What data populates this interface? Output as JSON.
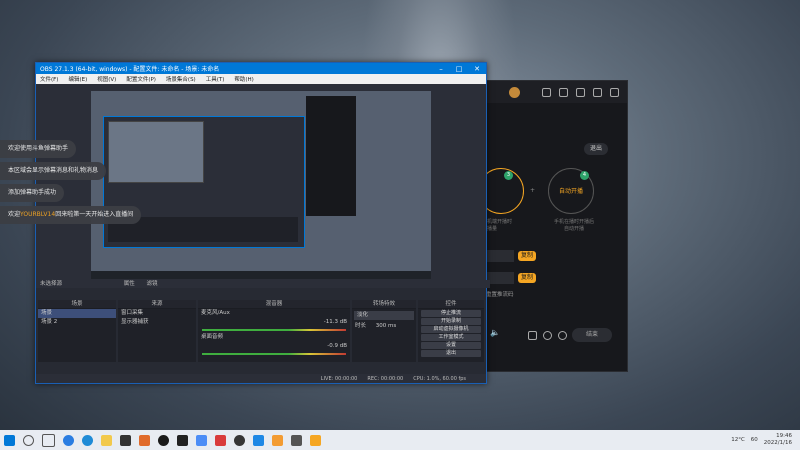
{
  "obs": {
    "title": "OBS 27.1.3 (64-bit, windows) - 配置文件: 未命名 - 场景: 未命名",
    "menu": [
      "文件(F)",
      "编辑(E)",
      "视图(V)",
      "配置文件(P)",
      "场景集合(S)",
      "工具(T)",
      "帮助(H)"
    ],
    "source_bar_text": "未选择源",
    "source_bar_buttons": [
      "属性",
      "滤镜"
    ],
    "docks": {
      "scenes": {
        "title": "场景",
        "items": [
          "场景",
          "场景 2"
        ]
      },
      "sources": {
        "title": "来源",
        "items": [
          "窗口采集",
          "显示器捕获"
        ]
      },
      "mixer": {
        "title": "混音器",
        "channels": [
          {
            "name": "麦克风/Aux",
            "db": "-11.3 dB"
          },
          {
            "name": "桌面音频",
            "db": "-0.9 dB"
          }
        ]
      },
      "transitions": {
        "title": "转场特效",
        "type": "淡化",
        "duration_label": "时长",
        "duration_value": "300 ms"
      },
      "controls": {
        "title": "控件",
        "buttons": [
          "停止推流",
          "开始录制",
          "启动虚拟摄像机",
          "工作室模式",
          "设置",
          "退出"
        ]
      }
    },
    "status": {
      "live": "LIVE: 00:00:00",
      "rec": "REC: 00:00:00",
      "cpu": "CPU: 1.0%, 60.00 fps"
    }
  },
  "side_app": {
    "exit_label": "退出",
    "circle_left_caption": "手机端开播时\n开播量",
    "circle_right_label": "自动开播",
    "circle_right_caption": "手机在播时开播后\n自动开播",
    "badge_left": "3",
    "badge_right": "4",
    "buttons": [
      "复制",
      "复制"
    ],
    "link_text": "重置推流码",
    "bottom_button": "结束"
  },
  "chat": [
    {
      "text": "欢迎使用斗鱼弹幕助手"
    },
    {
      "text": "本区域会显示弹幕消息和礼物消息"
    },
    {
      "text": "添加弹幕助手成功"
    },
    {
      "prefix": "欢迎",
      "highlight": "YOURBLV14",
      "suffix": "回来啦第一天开始进入直播间"
    }
  ],
  "taskbar": {
    "temperature": "12°C",
    "tray_text": "60",
    "time": "19:46",
    "date": "2022/1/16"
  }
}
